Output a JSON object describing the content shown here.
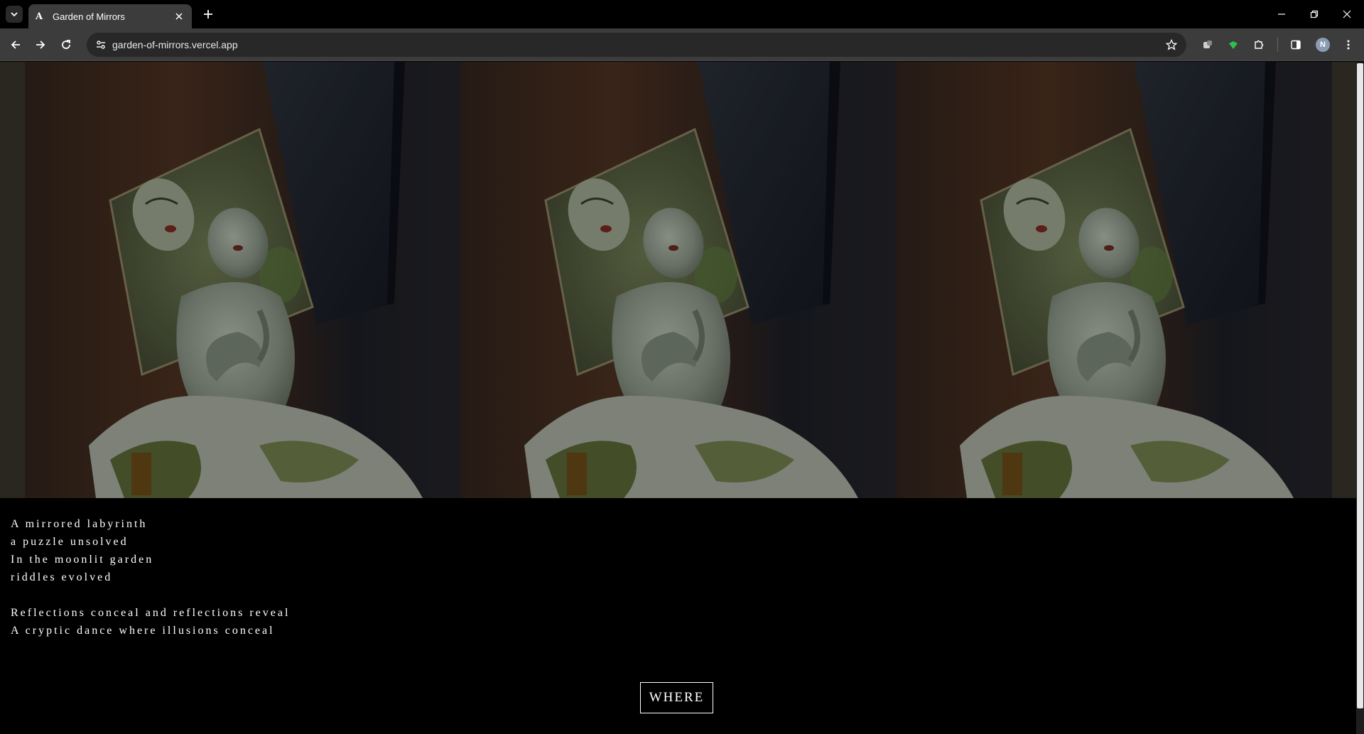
{
  "browser": {
    "tab": {
      "favicon": "A",
      "title": "Garden of Mirrors"
    },
    "url": "garden-of-mirrors.vercel.app",
    "profile_initial": "N"
  },
  "hero": {
    "image": "mirrored-sculpture-photo",
    "repeat": 3,
    "colors": {
      "wood": "#5a3a24",
      "shadow": "#1f2330",
      "marble": "#9aa89a",
      "moss": "#5a6a2a"
    }
  },
  "poem": {
    "stanza1": [
      "A mirrored labyrinth",
      "a puzzle unsolved",
      "In the moonlit garden",
      "riddles evolved"
    ],
    "stanza2": [
      "Reflections conceal and reflections reveal",
      "A cryptic dance where illusions conceal"
    ]
  },
  "cta": {
    "label": "WHERE"
  }
}
